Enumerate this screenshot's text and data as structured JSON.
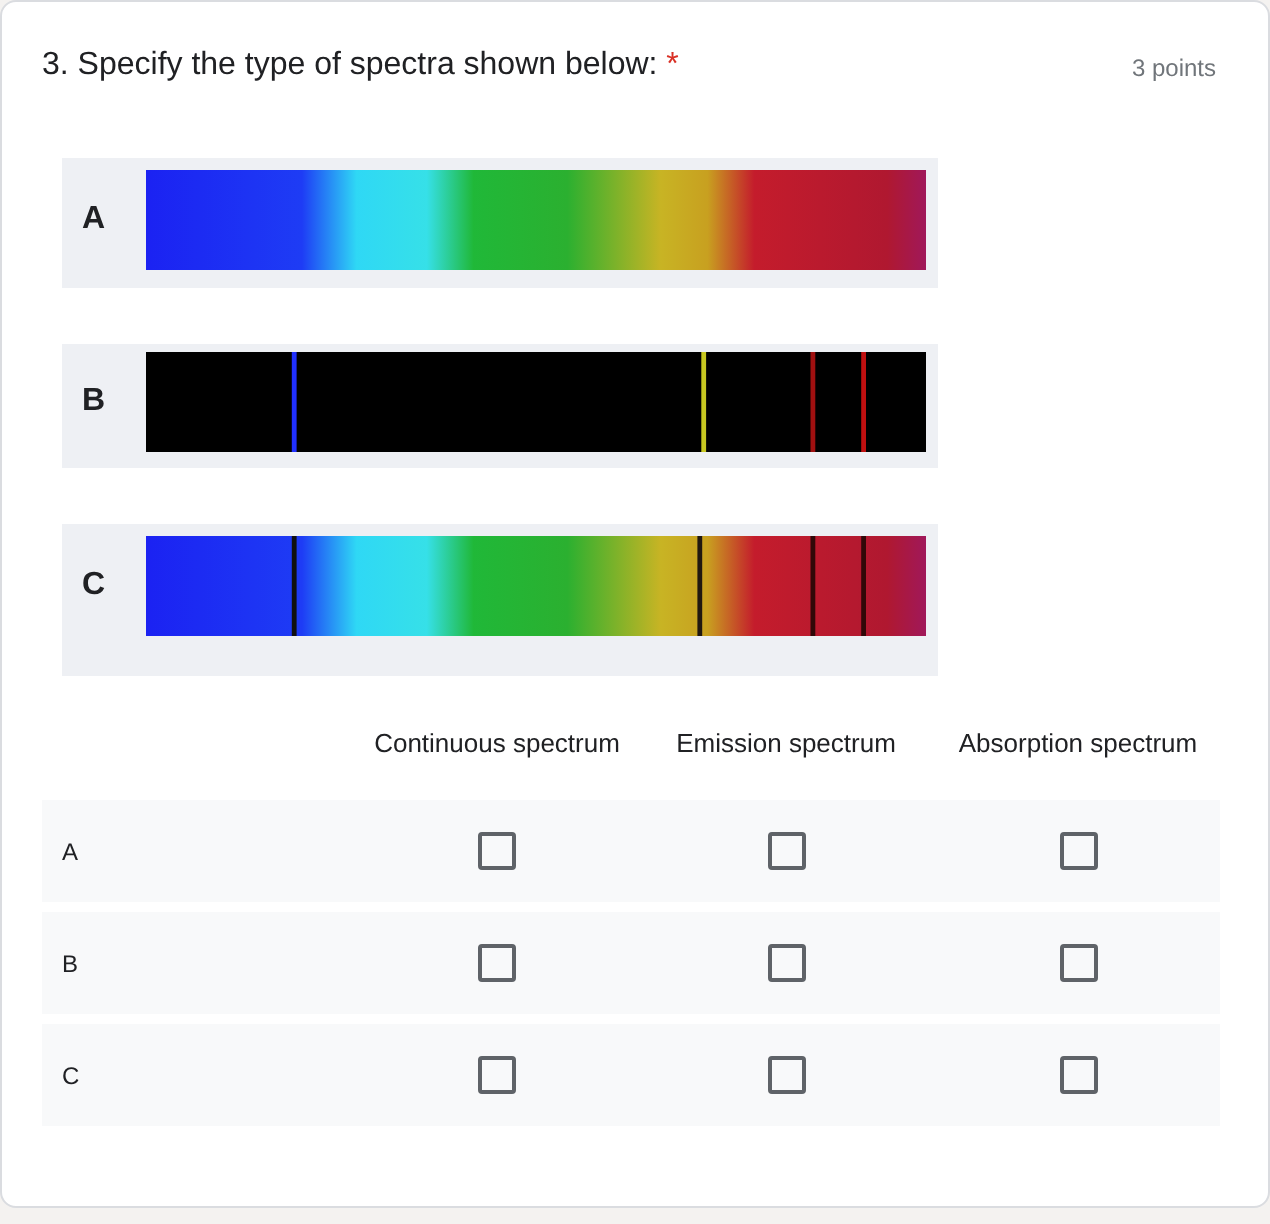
{
  "question": {
    "title": "3. Specify the type of spectra shown below:",
    "required_mark": "*",
    "points": "3 points"
  },
  "figure": {
    "spectra": [
      {
        "label": "A",
        "kind": "continuous"
      },
      {
        "label": "B",
        "kind": "emission"
      },
      {
        "label": "C",
        "kind": "absorption"
      }
    ]
  },
  "grid": {
    "columns": [
      "Continuous spectrum",
      "Emission spectrum",
      "Absorption spectrum"
    ],
    "rows": [
      {
        "label": "A",
        "checks": [
          {
            "checked": false
          },
          {
            "checked": false
          },
          {
            "checked": false
          }
        ]
      },
      {
        "label": "B",
        "checks": [
          {
            "checked": false
          },
          {
            "checked": false
          },
          {
            "checked": false
          }
        ]
      },
      {
        "label": "C",
        "checks": [
          {
            "checked": false
          },
          {
            "checked": false
          },
          {
            "checked": false
          }
        ]
      }
    ]
  }
}
